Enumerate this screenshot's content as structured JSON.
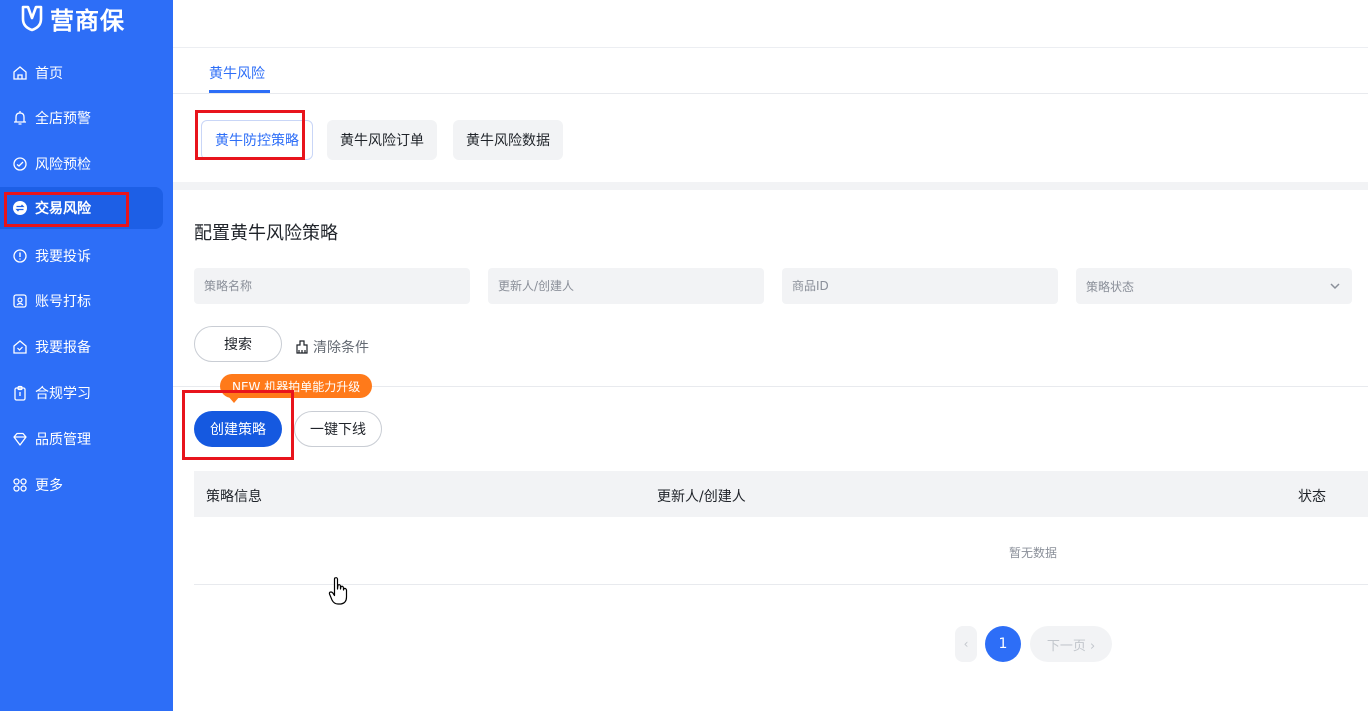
{
  "app": {
    "logo_text": "营商保"
  },
  "sidebar": {
    "items": [
      {
        "label": "首页",
        "icon": "home-icon"
      },
      {
        "label": "全店预警",
        "icon": "bell-icon"
      },
      {
        "label": "风险预检",
        "icon": "check-circle-icon"
      },
      {
        "label": "交易风险",
        "icon": "exchange-icon",
        "active": true
      },
      {
        "label": "我要投诉",
        "icon": "alert-circle-icon"
      },
      {
        "label": "账号打标",
        "icon": "id-card-icon"
      },
      {
        "label": "我要报备",
        "icon": "shield-home-icon"
      },
      {
        "label": "合规学习",
        "icon": "clipboard-icon"
      },
      {
        "label": "品质管理",
        "icon": "diamond-icon"
      },
      {
        "label": "更多",
        "icon": "grid-more-icon"
      }
    ]
  },
  "tabs": {
    "main": "黄牛风险"
  },
  "subtabs": [
    {
      "label": "黄牛防控策略",
      "active": true
    },
    {
      "label": "黄牛风险订单"
    },
    {
      "label": "黄牛风险数据"
    }
  ],
  "section": {
    "title": "配置黄牛风险策略"
  },
  "filters": {
    "name_placeholder": "策略名称",
    "updater_placeholder": "更新人/创建人",
    "product_placeholder": "商品ID",
    "status_placeholder": "策略状态"
  },
  "actions": {
    "search": "搜索",
    "clear": "清除条件",
    "badge": "NEW 机器拍单能力升级",
    "create": "创建策略",
    "offline": "一键下线"
  },
  "table": {
    "columns": [
      "策略信息",
      "更新人/创建人",
      "状态"
    ],
    "empty": "暂无数据"
  },
  "pagination": {
    "prev": "‹",
    "current": "1",
    "next": "下一页 ›"
  },
  "colors": {
    "sidebar": "#2d6ef7",
    "primary": "#1559e0",
    "badge": "#ff7a1a",
    "highlight": "#e8141c"
  }
}
